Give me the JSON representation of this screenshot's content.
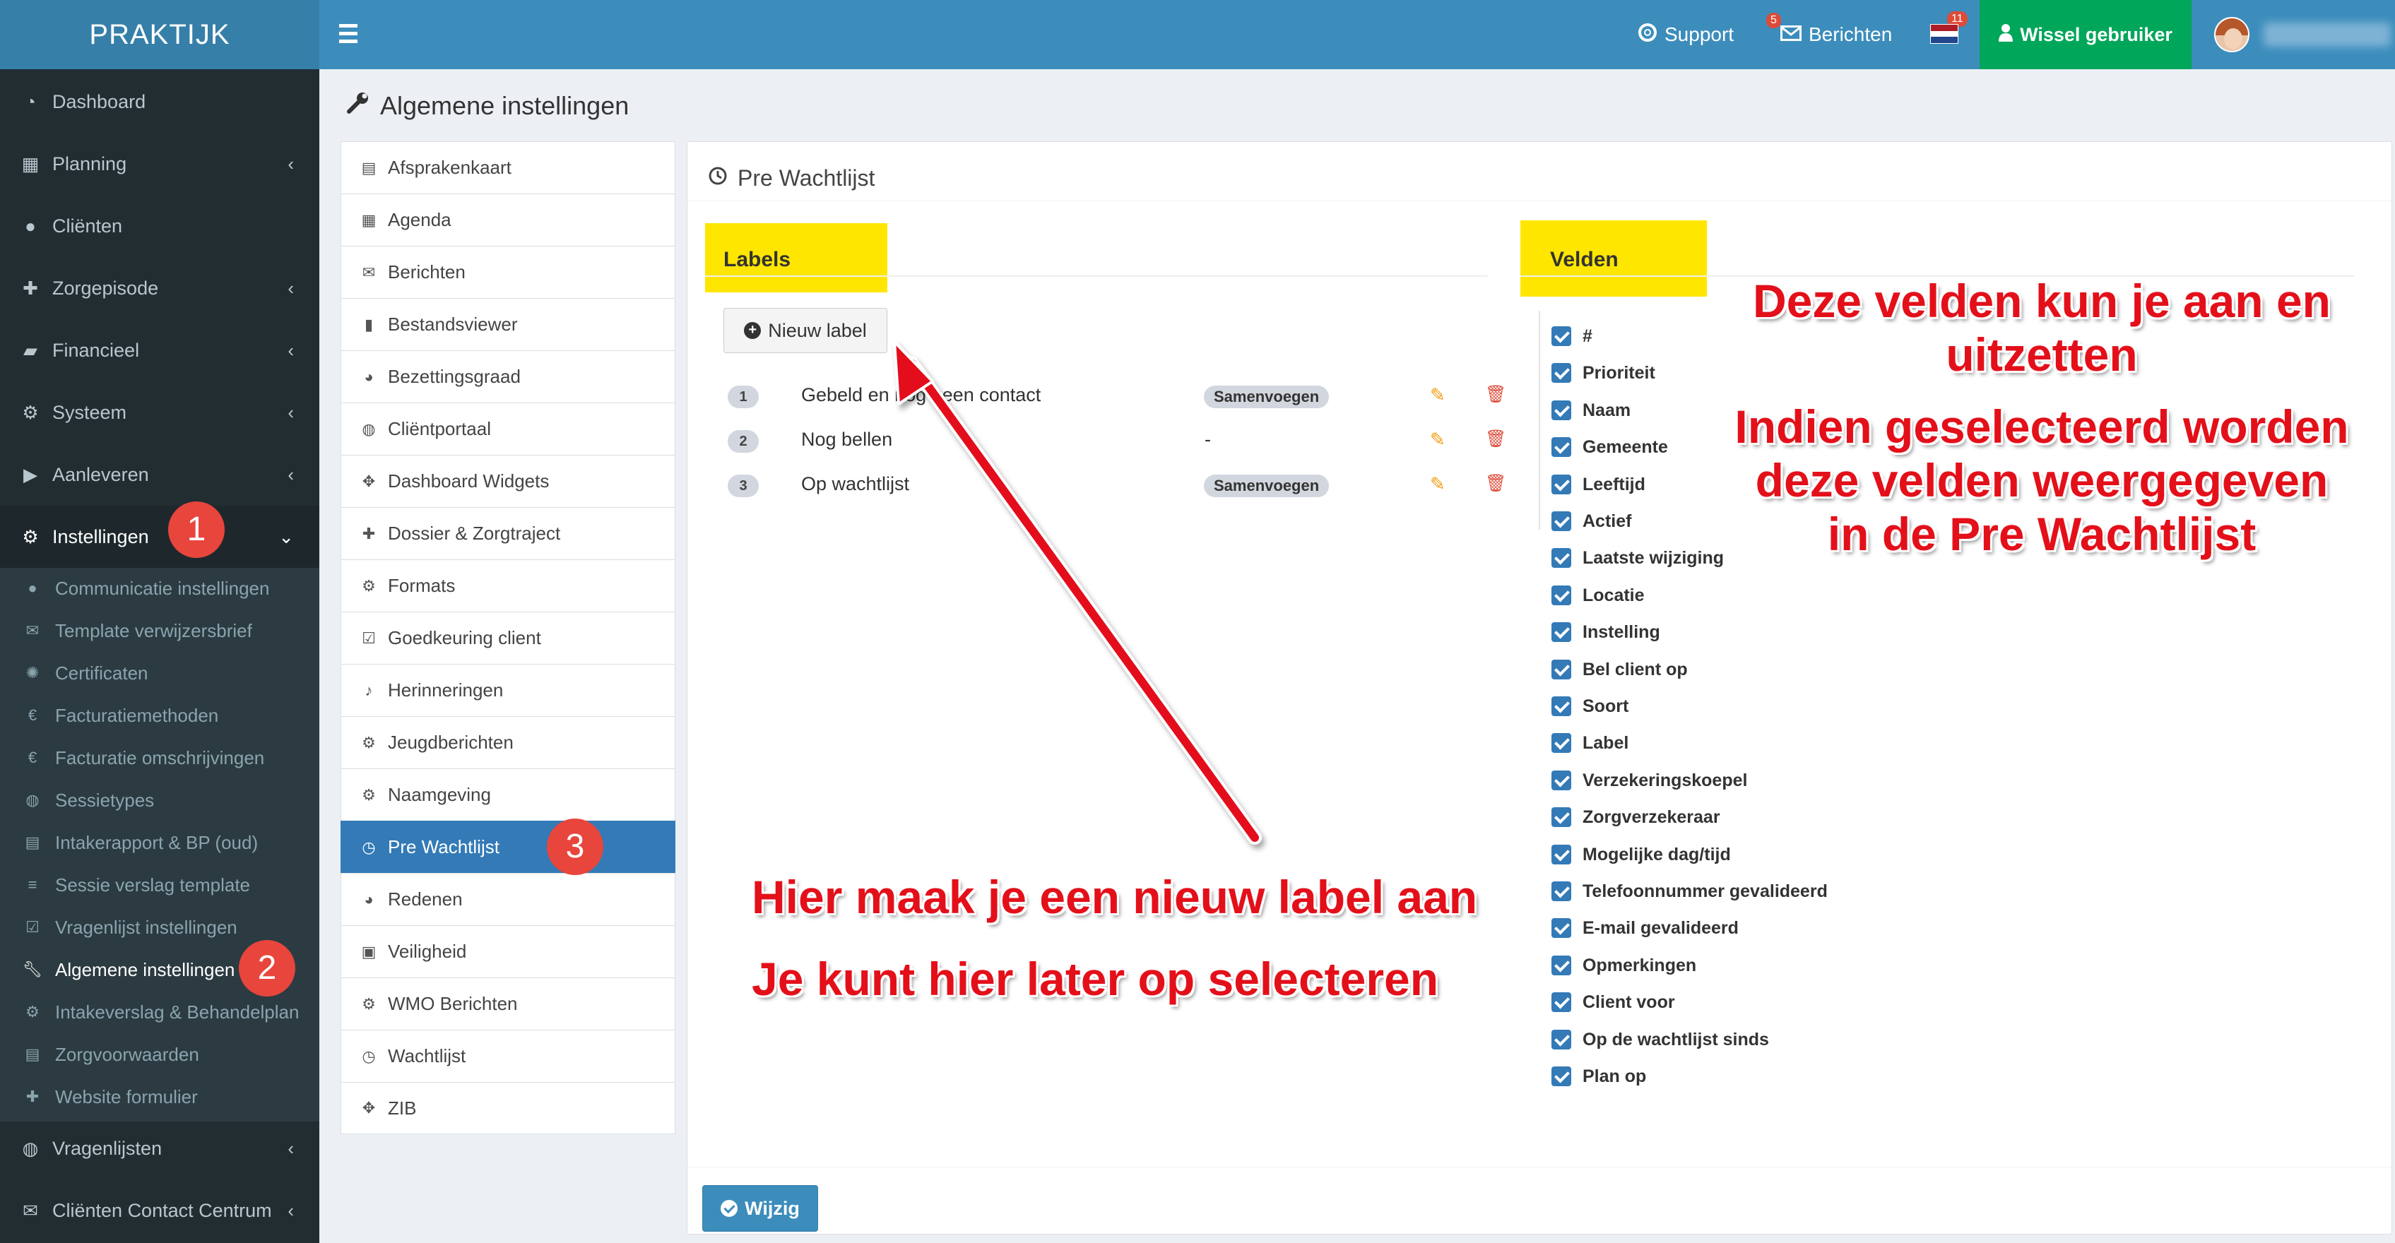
{
  "header": {
    "logo": "PRAKTIJK",
    "support_label": "Support",
    "support_badge": "5",
    "berichten_label": "Berichten",
    "berichten_badge": "11",
    "wissel_label": "Wissel gebruiker"
  },
  "sidebar": {
    "items": [
      {
        "label": "Dashboard",
        "icon": "dashboard-icon"
      },
      {
        "label": "Planning",
        "icon": "calendar-icon"
      },
      {
        "label": "Cliënten",
        "icon": "user-icon"
      },
      {
        "label": "Zorgepisode",
        "icon": "medkit-icon"
      },
      {
        "label": "Financieel",
        "icon": "book-icon"
      },
      {
        "label": "Systeem",
        "icon": "cogs-icon"
      },
      {
        "label": "Aanleveren",
        "icon": "truck-icon"
      },
      {
        "label": "Instellingen",
        "icon": "gear-icon"
      }
    ],
    "sub_items": [
      "Communicatie instellingen",
      "Template verwijzersbrief",
      "Certificaten",
      "Facturatiemethoden",
      "Facturatie omschrijvingen",
      "Sessietypes",
      "Intakerapport & BP (oud)",
      "Sessie verslag template",
      "Vragenlijst instellingen",
      "Algemene instellingen",
      "Intakeverslag & Behandelplan",
      "Zorgvoorwaarden",
      "Website formulier"
    ],
    "bottom_items": [
      "Vragenlijsten",
      "Cliënten Contact Centrum"
    ]
  },
  "page": {
    "title": "Algemene instellingen"
  },
  "settings_menu": [
    "Afsprakenkaart",
    "Agenda",
    "Berichten",
    "Bestandsviewer",
    "Bezettingsgraad",
    "Cliëntportaal",
    "Dashboard Widgets",
    "Dossier & Zorgtraject",
    "Formats",
    "Goedkeuring client",
    "Herinneringen",
    "Jeugdberichten",
    "Naamgeving",
    "Pre Wachtlijst",
    "Redenen",
    "Veiligheid",
    "WMO Berichten",
    "Wachtlijst",
    "ZIB"
  ],
  "panel": {
    "title": "Pre Wachtlijst",
    "labels_heading": "Labels",
    "velden_heading": "Velden",
    "new_label_button": "Nieuw label",
    "labels": [
      {
        "num": "1",
        "name": "Gebeld en nog geen contact",
        "tag": "Samenvoegen"
      },
      {
        "num": "2",
        "name": "Nog bellen",
        "tag": "-"
      },
      {
        "num": "3",
        "name": "Op wachtlijst",
        "tag": "Samenvoegen"
      }
    ],
    "fields": [
      "#",
      "Prioriteit",
      "Naam",
      "Gemeente",
      "Leeftijd",
      "Actief",
      "Laatste wijziging",
      "Locatie",
      "Instelling",
      "Bel client op",
      "Soort",
      "Label",
      "Verzekeringskoepel",
      "Zorgverzekeraar",
      "Mogelijke dag/tijd",
      "Telefoonnummer gevalideerd",
      "E-mail gevalideerd",
      "Opmerkingen",
      "Client voor",
      "Op de wachtlijst sinds",
      "Plan op"
    ],
    "submit_button": "Wijzig"
  },
  "annotations": {
    "step1": "1",
    "step2": "2",
    "step3": "3",
    "fields_line1": "Deze velden kun je aan en",
    "fields_line2": "uitzetten",
    "fields_line3": "Indien geselecteerd worden",
    "fields_line4": "deze velden weergegeven",
    "fields_line5": "in de Pre Wachtlijst",
    "label_line1": "Hier maak je een nieuw label aan",
    "label_line2": "Je kunt hier later op selecteren"
  },
  "colors": {
    "topbar": "#3c8dbc",
    "logo_bg": "#367fa9",
    "sidebar": "#222d32",
    "wissel": "#00a65a",
    "selected": "#337ab7",
    "highlight": "#ffe600",
    "annotation_red": "#e3101a"
  }
}
